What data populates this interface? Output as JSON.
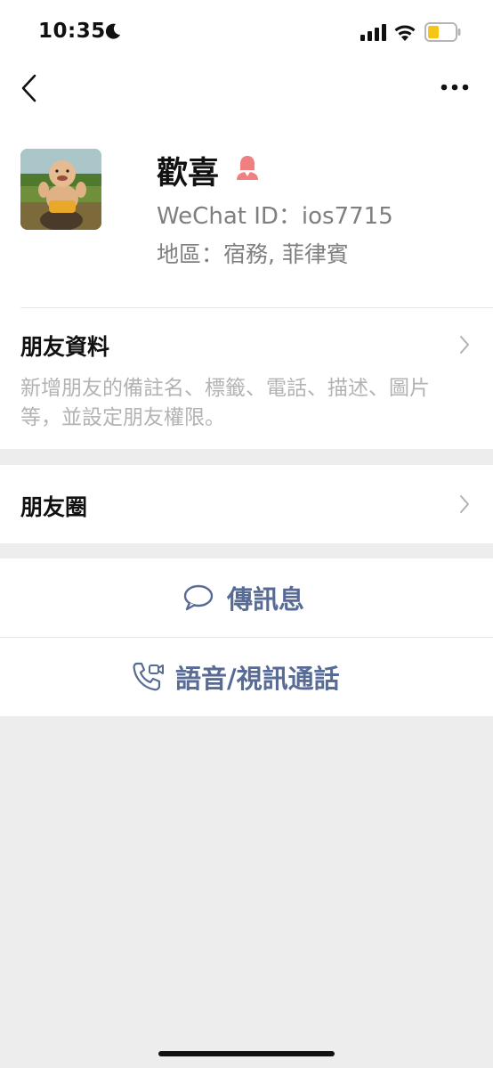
{
  "status_bar": {
    "time": "10:35"
  },
  "profile": {
    "name": "歡喜",
    "wechat_id": "WeChat ID：ios7715",
    "region": "地區：宿務, 菲律賓"
  },
  "friend_info": {
    "title": "朋友資料",
    "description": "新增朋友的備註名、標籤、電話、描述、圖片等，並設定朋友權限。"
  },
  "moments": {
    "title": "朋友圈"
  },
  "actions": {
    "message_label": "傳訊息",
    "call_label": "語音/視訊通話"
  },
  "colors": {
    "accent": "#576b95",
    "gender_icon": "#f08080",
    "battery": "#f5c518"
  }
}
